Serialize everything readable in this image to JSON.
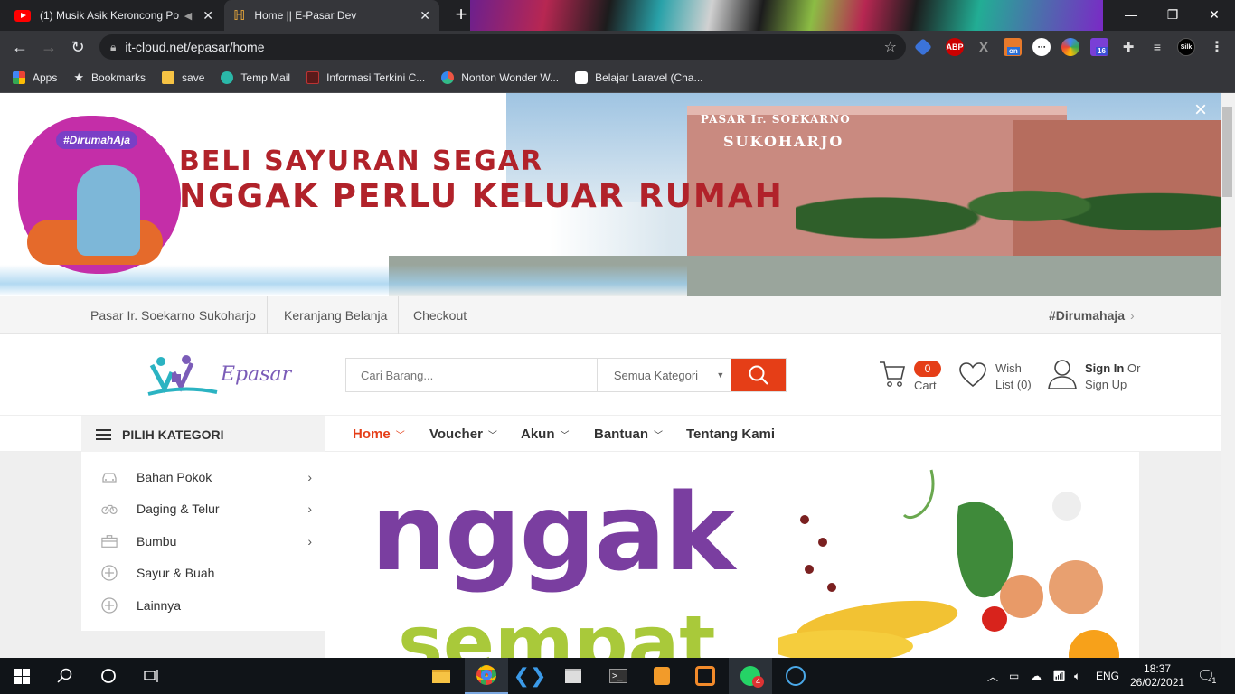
{
  "browser": {
    "tabs": [
      {
        "title": "(1) Musik Asik Keroncong Po",
        "icon": "youtube-icon"
      },
      {
        "title": "Home || E-Pasar Dev",
        "icon": "epasar-favicon"
      }
    ],
    "new_tab": "+",
    "url": "it-cloud.net/epasar/home",
    "extension_badges": {
      "abp": "ABP",
      "on": "on",
      "count": "16",
      "silk": "Silk"
    },
    "bookmarks": [
      {
        "label": "Apps",
        "icon": "apps-grid-icon",
        "color": "#4285f4"
      },
      {
        "label": "Bookmarks",
        "icon": "star-icon",
        "color": "#e8eaed"
      },
      {
        "label": "save",
        "icon": "folder-icon",
        "color": "#f6c344"
      },
      {
        "label": "Temp Mail",
        "icon": "tempmail-icon",
        "color": "#2ab8a8"
      },
      {
        "label": "Informasi Terkini C...",
        "icon": "news-icon",
        "color": "#b33"
      },
      {
        "label": "Nonton Wonder W...",
        "icon": "pinwheel-icon",
        "color": "#e54"
      },
      {
        "label": "Belajar Laravel (Cha...",
        "icon": "medium-icon",
        "color": "#fff"
      }
    ]
  },
  "hero": {
    "tag": "#DirumahAja",
    "line1": "BELI SAYURAN SEGAR",
    "line2": "NGGAK PERLU KELUAR RUMAH",
    "building_sign1": "PASAR Ir. SOEKARNO",
    "building_sign2": "SUKOHARJO",
    "close": "×"
  },
  "topnav": {
    "links": [
      "Pasar Ir. Soekarno Sukoharjo",
      "Keranjang Belanja",
      "Checkout"
    ],
    "tag": "#Dirumahaja",
    "tag_arrow": "›"
  },
  "header": {
    "logo_text": "Epasar",
    "search_placeholder": "Cari Barang...",
    "category_select": "Semua Kategori",
    "cart_count": "0",
    "cart_label": "Cart",
    "wish_line1": "Wish",
    "wish_line2": "List (0)",
    "signin": "Sign In",
    "or": "Or",
    "signup": "Sign Up"
  },
  "menu": {
    "category_header": "PILIH KATEGORI",
    "items": [
      {
        "label": "Home",
        "active": true
      },
      {
        "label": "Voucher"
      },
      {
        "label": "Akun"
      },
      {
        "label": "Bantuan"
      },
      {
        "label": "Tentang Kami"
      }
    ]
  },
  "sidebar": {
    "items": [
      {
        "label": "Bahan Pokok",
        "icon": "car-icon",
        "has_sub": true
      },
      {
        "label": "Daging & Telur",
        "icon": "bicycle-icon",
        "has_sub": true
      },
      {
        "label": "Bumbu",
        "icon": "briefcase-icon",
        "has_sub": true
      },
      {
        "label": "Sayur & Buah",
        "icon": "plus-circle-icon",
        "has_sub": false
      },
      {
        "label": "Lainnya",
        "icon": "plus-circle-icon",
        "has_sub": false
      }
    ]
  },
  "promo": {
    "word1": "nggak",
    "word2": "sempat"
  },
  "taskbar": {
    "language": "ENG",
    "time": "18:37",
    "date": "26/02/2021",
    "whatsapp_badge": "4",
    "notification_count": "1"
  },
  "colors": {
    "accent": "#e53e17",
    "promo_purple": "#7a3ea0",
    "promo_green": "#a9c93a",
    "hero_text": "#b1222a"
  }
}
